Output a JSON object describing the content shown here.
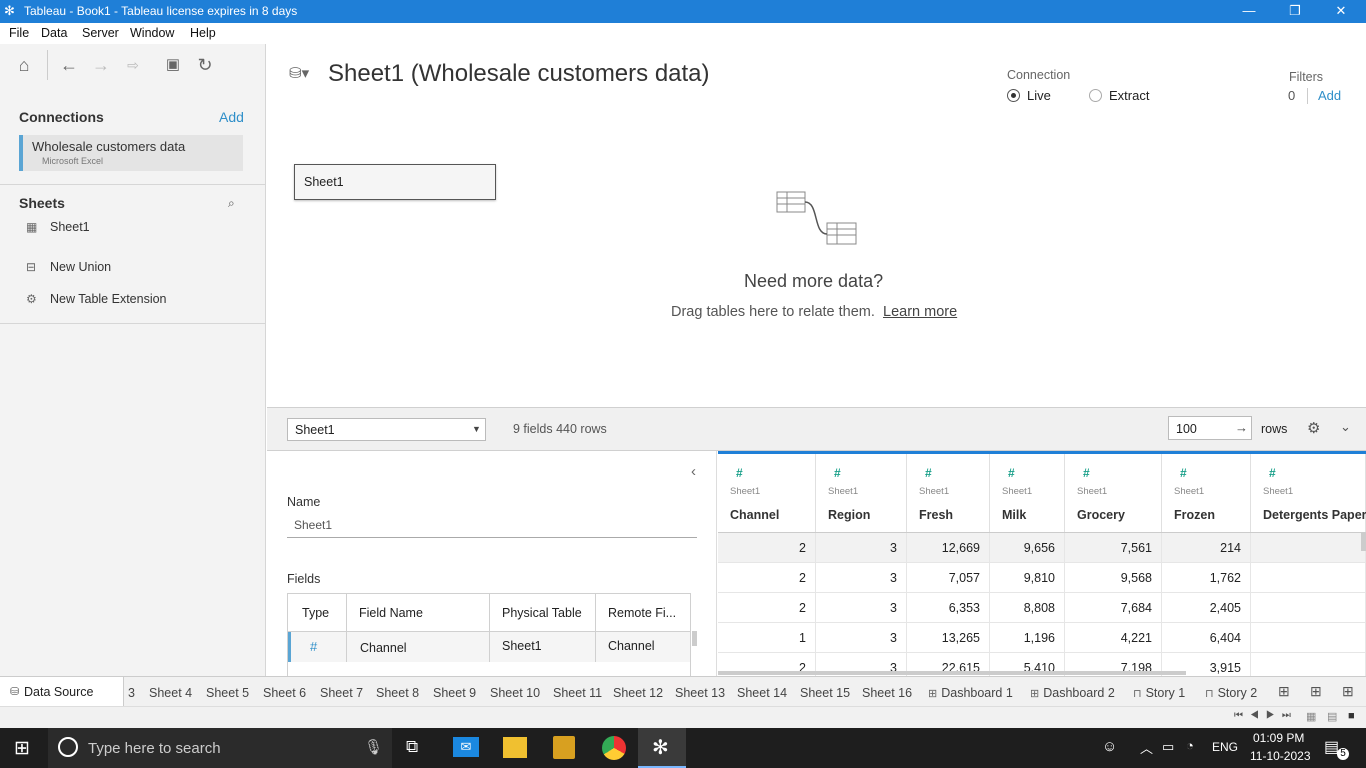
{
  "window": {
    "title": "Tableau - Book1 - Tableau license expires in 8 days",
    "minimize": "—",
    "restore": "❐",
    "close": "✕"
  },
  "menu": [
    "File",
    "Data",
    "Server",
    "Window",
    "Help"
  ],
  "left": {
    "connections_title": "Connections",
    "add_label": "Add",
    "connection": {
      "name": "Wholesale customers data",
      "type": "Microsoft Excel"
    },
    "sheets_title": "Sheets",
    "sheets": [
      "Sheet1"
    ],
    "new_union": "New Union",
    "new_table_extension": "New Table Extension"
  },
  "canvas": {
    "title": "Sheet1 (Wholesale customers data)",
    "connection_label": "Connection",
    "live_label": "Live",
    "extract_label": "Extract",
    "filters_label": "Filters",
    "filters_count": "0",
    "filters_add": "Add",
    "sheet_card": "Sheet1",
    "need_more": "Need more data?",
    "drag_text": "Drag tables here to relate them.",
    "learn_more": "Learn more"
  },
  "midbar": {
    "table_select": "Sheet1",
    "summary": "9 fields 440 rows",
    "rows_value": "100",
    "rows_label": "rows"
  },
  "meta": {
    "name_label": "Name",
    "name_value": "Sheet1",
    "fields_label": "Fields",
    "columns": [
      "Type",
      "Field Name",
      "Physical Table",
      "Remote Fi..."
    ],
    "rows": [
      {
        "type": "#",
        "field": "Channel",
        "table": "Sheet1",
        "remote": "Channel"
      }
    ]
  },
  "grid": {
    "source": "Sheet1",
    "columns": [
      "Channel",
      "Region",
      "Fresh",
      "Milk",
      "Grocery",
      "Frozen",
      "Detergents Paper"
    ],
    "rows": [
      [
        "2",
        "3",
        "12,669",
        "9,656",
        "7,561",
        "214",
        ""
      ],
      [
        "2",
        "3",
        "7,057",
        "9,810",
        "9,568",
        "1,762",
        ""
      ],
      [
        "2",
        "3",
        "6,353",
        "8,808",
        "7,684",
        "2,405",
        ""
      ],
      [
        "1",
        "3",
        "13,265",
        "1,196",
        "4,221",
        "6,404",
        ""
      ],
      [
        "2",
        "3",
        "22,615",
        "5,410",
        "7,198",
        "3,915",
        ""
      ]
    ]
  },
  "tabs": {
    "data_source": "Data Source",
    "partial": "3",
    "sheets": [
      "Sheet 4",
      "Sheet 5",
      "Sheet 6",
      "Sheet 7",
      "Sheet 8",
      "Sheet 9",
      "Sheet 10",
      "Sheet 11",
      "Sheet 12",
      "Sheet 13",
      "Sheet 14",
      "Sheet 15",
      "Sheet 16"
    ],
    "dashboards": [
      "Dashboard 1",
      "Dashboard 2"
    ],
    "stories": [
      "Story 1",
      "Story 2"
    ]
  },
  "taskbar": {
    "search_placeholder": "Type here to search",
    "lang": "ENG",
    "time": "01:09 PM",
    "date": "11-10-2023",
    "notif_count": "5"
  }
}
